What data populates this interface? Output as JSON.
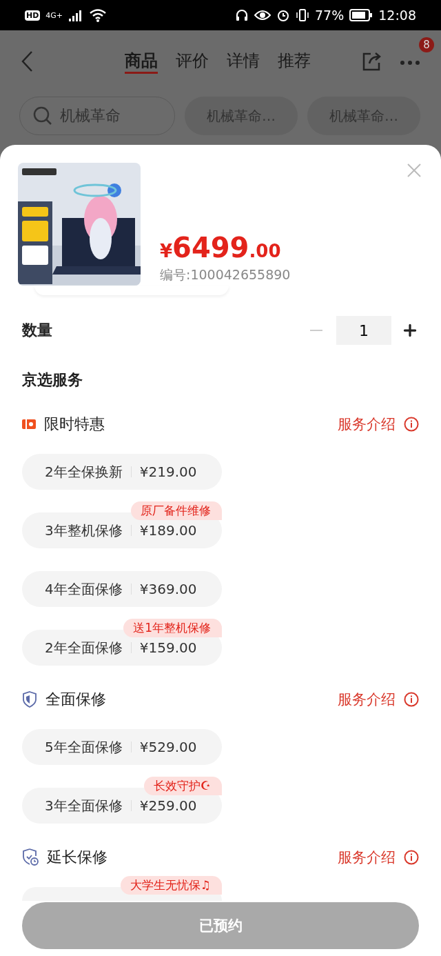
{
  "status_bar": {
    "hd": "HD",
    "network": "4G+",
    "battery": "77%",
    "time": "12:08"
  },
  "nav": {
    "tabs": [
      {
        "label": "商品",
        "selected": true
      },
      {
        "label": "评价",
        "selected": false
      },
      {
        "label": "详情",
        "selected": false
      },
      {
        "label": "推荐",
        "selected": false
      }
    ],
    "badge": "8"
  },
  "search": {
    "placeholder": "机械革命",
    "chips": [
      "机械革命…",
      "机械革命…"
    ]
  },
  "sheet": {
    "product": {
      "kind": "picture",
      "price": {
        "currency": "¥",
        "integer": "6499",
        "decimal": ".00"
      },
      "sku": "编号:100042655890"
    },
    "quantity": {
      "label": "数量",
      "value": "1",
      "minus_disabled": true
    },
    "services_title": "京选服务",
    "groups": [
      {
        "kind": "deal",
        "title": "限时特惠",
        "link": "服务介绍",
        "options": [
          {
            "name": "2年全保换新",
            "price": "¥219.00"
          },
          {
            "name": "3年整机保修",
            "price": "¥189.00",
            "tag": "原厂备件维修"
          },
          {
            "name": "4年全面保修",
            "price": "¥369.00"
          },
          {
            "name": "2年全面保修",
            "price": "¥159.00",
            "tag": "送1年整机保修"
          }
        ]
      },
      {
        "kind": "shield",
        "title": "全面保修",
        "link": "服务介绍",
        "options": [
          {
            "name": "5年全面保修",
            "price": "¥529.00"
          },
          {
            "name": "3年全面保修",
            "price": "¥259.00",
            "tag": "长效守护☪"
          }
        ]
      },
      {
        "kind": "shield-clock",
        "title": "延长保修",
        "link": "服务介绍",
        "options": [
          {
            "tag": "大学生无忧保♫"
          }
        ]
      }
    ],
    "action": {
      "label": "已预约",
      "disabled": true
    }
  }
}
